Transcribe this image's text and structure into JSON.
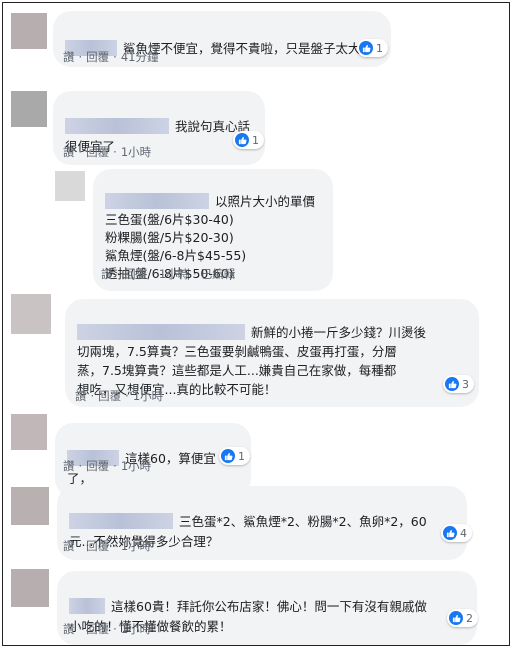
{
  "comments": [
    {
      "text": "鯊魚煙不便宜，覺得不貴啦，只是盤子太大",
      "likes": "1",
      "actions": {
        "reply_prefix": "讚",
        "reply": "回覆",
        "time": "41分鐘"
      }
    },
    {
      "text": "我說句真心話\n很便宜了",
      "likes": "1",
      "actions": {
        "reply_prefix": "讚",
        "reply": "回覆",
        "time": "1小時"
      }
    },
    {
      "text": "以照片大小的單價\n三色蛋(盤/6片$30-40)\n粉粿腸(盤/5片$20-30)\n鯊魚煙(盤/6-8片$45-55)\n透抽(盤/6-8片$50-60)",
      "actions": {
        "reply_prefix": "讚",
        "reply": "回覆",
        "time": "1小時",
        "edited": "已編輯"
      }
    },
    {
      "text": "新鮮的小捲一斤多少錢？川燙後\n切兩塊，7.5算貴？三色蛋要剝鹹鴨蛋、皮蛋再打蛋，分層\n蒸，7.5塊算貴？這些都是人工...嫌貴自己在家做，每種都\n想吃，又想便宜...真的比較不可能！",
      "likes": "3",
      "actions": {
        "reply_prefix": "讚",
        "reply": "回覆",
        "time": "1小時"
      }
    },
    {
      "text": "這樣60，算便宜了，",
      "likes": "1",
      "actions": {
        "reply_prefix": "讚",
        "reply": "回覆",
        "time": "1小時"
      }
    },
    {
      "text": "三色蛋*2、鯊魚煙*2、粉腸*2、魚卵*2，60\n元...不然妳覺得多少合理？",
      "likes": "4",
      "actions": {
        "reply_prefix": "讚",
        "reply": "回覆",
        "time": "1小時"
      }
    },
    {
      "text": "這樣60貴！拜託你公布店家！佛心！問一下有沒有親戚做\n小吃的！懂不懂做餐飲的累！",
      "likes": "2",
      "actions": {
        "reply_prefix": "讚",
        "reply": "回覆",
        "time": "1小時"
      }
    }
  ]
}
